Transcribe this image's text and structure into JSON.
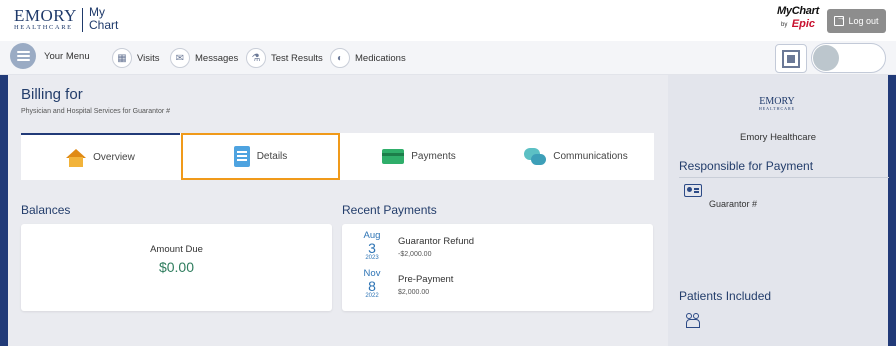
{
  "header": {
    "brand_big": "EMORY",
    "brand_small": "HEALTHCARE",
    "app_name_line1": "My",
    "app_name_line2": "Chart",
    "mychart_label": "MyChart",
    "by_label": "by",
    "epic_label": "Epic",
    "logout_label": "Log out"
  },
  "nav": {
    "menu_label": "Your Menu",
    "items": [
      {
        "label": "Visits",
        "icon": "calendar-icon"
      },
      {
        "label": "Messages",
        "icon": "envelope-icon"
      },
      {
        "label": "Test Results",
        "icon": "flask-icon"
      },
      {
        "label": "Medications",
        "icon": "pill-icon"
      }
    ]
  },
  "page": {
    "title": "Billing for",
    "subtitle": "Physician and Hospital Services for Guarantor #"
  },
  "tabs": [
    {
      "label": "Overview",
      "icon": "house-icon",
      "active": true
    },
    {
      "label": "Details",
      "icon": "document-icon",
      "highlighted": true
    },
    {
      "label": "Payments",
      "icon": "credit-card-icon"
    },
    {
      "label": "Communications",
      "icon": "chat-bubbles-icon"
    }
  ],
  "balances": {
    "heading": "Balances",
    "amount_label": "Amount Due",
    "amount_value": "$0.00"
  },
  "recent_payments": {
    "heading": "Recent Payments",
    "items": [
      {
        "month": "Aug",
        "day": "3",
        "year": "2023",
        "title": "Guarantor Refund",
        "amount": "-$2,000.00"
      },
      {
        "month": "Nov",
        "day": "8",
        "year": "2022",
        "title": "Pre-Payment",
        "amount": "$2,000.00"
      }
    ]
  },
  "sidebar": {
    "logo_big": "EMORY",
    "logo_small": "HEALTHCARE",
    "org_name": "Emory Healthcare",
    "responsible_heading": "Responsible for Payment",
    "guarantor_label": "Guarantor #",
    "patients_heading": "Patients Included"
  },
  "colors": {
    "brand_navy": "#213a78",
    "title_blue": "#233d6b",
    "amount_green": "#2f7d5e",
    "date_blue": "#2e74b5",
    "highlight_orange": "#f09a1a",
    "logout_gray": "#8d8d8d",
    "epic_red": "#c8102e"
  }
}
